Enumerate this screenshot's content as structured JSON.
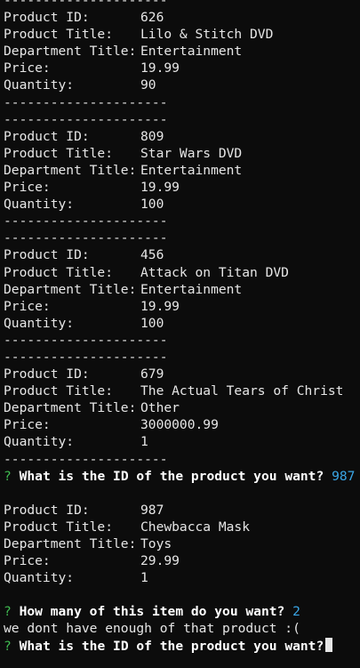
{
  "separator": "---------------------",
  "labels": {
    "id": "Product ID:",
    "title": "Product Title:",
    "department": "Department Title:",
    "price": "Price:",
    "quantity": "Quantity:"
  },
  "products": [
    {
      "id": "626",
      "title": "Lilo & Stitch DVD",
      "department": "Entertainment",
      "price": "19.99",
      "quantity": "90"
    },
    {
      "id": "809",
      "title": "Star Wars DVD",
      "department": "Entertainment",
      "price": "19.99",
      "quantity": "100"
    },
    {
      "id": "456",
      "title": "Attack on Titan DVD",
      "department": "Entertainment",
      "price": "19.99",
      "quantity": "100"
    },
    {
      "id": "679",
      "title": "The Actual Tears of Christ",
      "department": "Other",
      "price": "3000000.99",
      "quantity": "1"
    }
  ],
  "prompt1": {
    "mark": "?",
    "question": "What is the ID of the product you want?",
    "answer": "987"
  },
  "selected": {
    "id": "987",
    "title": "Chewbacca Mask",
    "department": "Toys",
    "price": "29.99",
    "quantity": "1"
  },
  "prompt2": {
    "mark": "?",
    "question": "How many of this item do you want?",
    "answer": "2"
  },
  "message": "we dont have enough of that product :(",
  "prompt3": {
    "mark": "?",
    "question": "What is the ID of the product you want?"
  }
}
